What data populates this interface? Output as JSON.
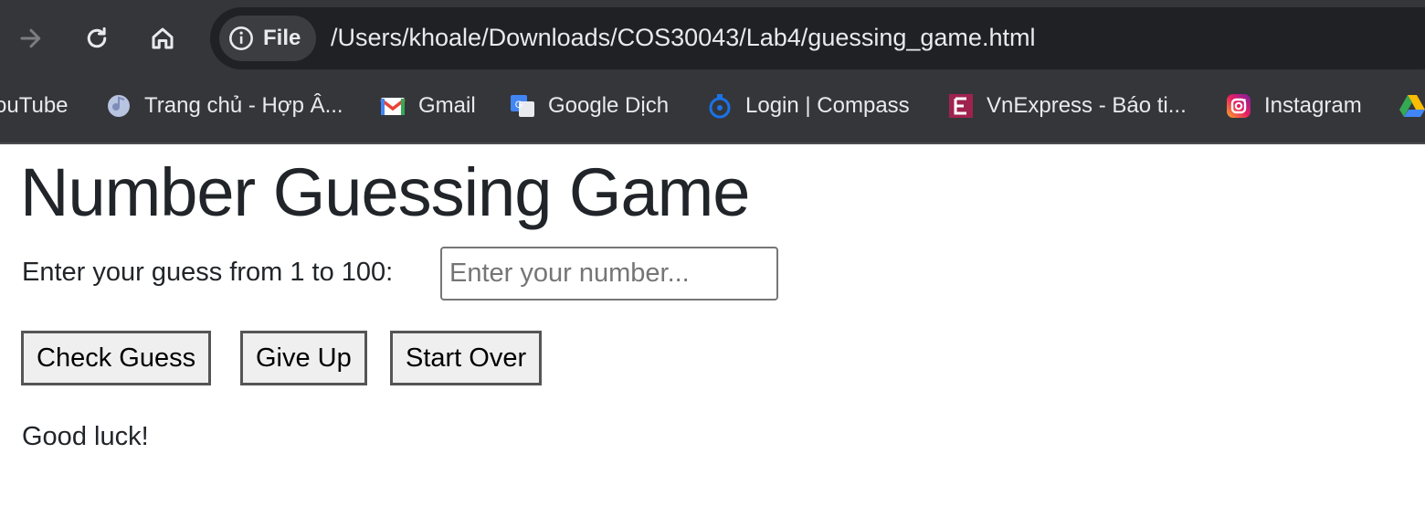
{
  "browser": {
    "site_chip_label": "File",
    "url": "/Users/khoale/Downloads/COS30043/Lab4/guessing_game.html",
    "bookmarks": [
      {
        "label": "ouTube",
        "icon": "youtube-icon"
      },
      {
        "label": "Trang chủ - Hợp Â...",
        "icon": "hop-am-icon"
      },
      {
        "label": "Gmail",
        "icon": "gmail-icon"
      },
      {
        "label": "Google Dịch",
        "icon": "google-translate-icon"
      },
      {
        "label": "Login | Compass",
        "icon": "compass-icon"
      },
      {
        "label": "VnExpress - Báo ti...",
        "icon": "vnexpress-icon"
      },
      {
        "label": "Instagram",
        "icon": "instagram-icon"
      },
      {
        "label": "",
        "icon": "google-drive-icon"
      }
    ]
  },
  "page": {
    "title": "Number Guessing Game",
    "guess_label": "Enter your guess from 1 to 100:",
    "guess_placeholder": "Enter your number...",
    "guess_value": "",
    "buttons": {
      "check": "Check Guess",
      "give_up": "Give Up",
      "start_over": "Start Over"
    },
    "status": "Good luck!"
  },
  "colors": {
    "chrome_bg": "#35363a",
    "omnibox_bg": "#202124",
    "text": "#212529"
  }
}
